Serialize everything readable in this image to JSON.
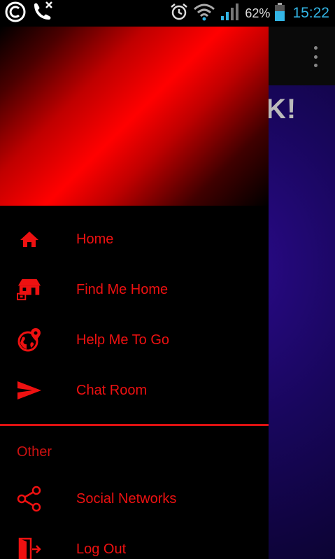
{
  "status_bar": {
    "battery_percent": "62%",
    "time": "15:22"
  },
  "background_app": {
    "partial_title": "K!"
  },
  "drawer": {
    "main_items": [
      {
        "label": "Home",
        "icon": "home-icon"
      },
      {
        "label": "Find Me Home",
        "icon": "house-sale-icon"
      },
      {
        "label": "Help Me To Go",
        "icon": "globe-pin-icon"
      },
      {
        "label": "Chat Room",
        "icon": "send-icon"
      }
    ],
    "section_title": "Other",
    "other_items": [
      {
        "label": "Social Networks",
        "icon": "share-icon"
      },
      {
        "label": "Log Out",
        "icon": "logout-icon"
      }
    ]
  },
  "colors": {
    "accent": "#ee1111",
    "status_time": "#33b5e5"
  }
}
